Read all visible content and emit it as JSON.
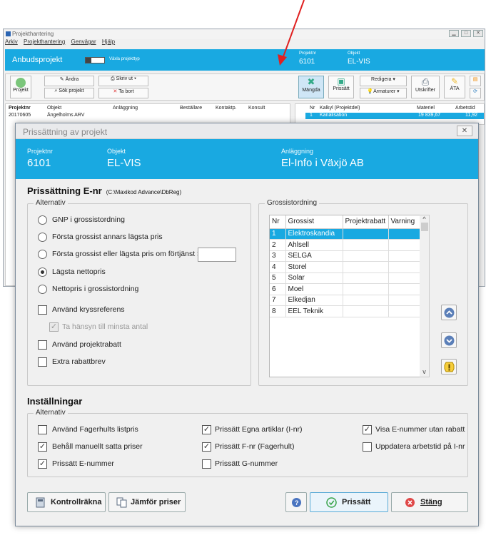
{
  "bg": {
    "window_title": "Projekthantering",
    "menu": [
      "Arkiv",
      "Projekthantering",
      "Genvägar",
      "Hjälp"
    ],
    "banner_title": "Anbudsprojekt",
    "banner_toggle_label": "Växla projekttyp",
    "projektnr_label": "Projektnr",
    "projektnr": "6101",
    "objekt_label": "Objekt",
    "objekt": "EL-VIS",
    "toolbar": {
      "projekt": "Projekt",
      "andra": "Ändra",
      "sok_projekt": "Sök projekt",
      "skriv_ut": "Skriv ut",
      "ta_bort": "Ta bort",
      "mangda": "Mängda",
      "prissatt": "Prissätt",
      "redigera": "Redigera",
      "armaturer": "Armaturer",
      "utskrifter": "Utskrifter",
      "ata": "ÄTA"
    },
    "left_columns": [
      "Projektnr",
      "Objekt",
      "Anläggning",
      "Beställare",
      "Kontaktp.",
      "Konsult"
    ],
    "left_row": [
      "20170605",
      "Ängelholms ARV"
    ],
    "right_columns": [
      "Nr",
      "Kalkyl (Projektdel)",
      "Materiel",
      "Arbetstid"
    ],
    "right_row": [
      "1",
      "Kanalisation",
      "19 839,67",
      "11,92"
    ]
  },
  "dialog": {
    "title": "Prissättning av projekt",
    "banner": {
      "projektnr_label": "Projektnr",
      "projektnr": "6101",
      "objekt_label": "Objekt",
      "objekt": "EL-VIS",
      "anlaggning_label": "Anläggning",
      "anlaggning": "El-Info i Växjö AB"
    },
    "heading": "Prissättning E-nr",
    "path": "(C:\\Maxikod Advance\\DbReg)",
    "alternativ_label": "Alternativ",
    "radios": [
      "GNP i grossistordning",
      "Första grossist annars lägsta pris",
      "Första grossist eller lägsta pris om förtjänst  >",
      "Lägsta nettopris",
      "Nettopris i grossistordning"
    ],
    "selected_radio": 3,
    "checkboxes": {
      "kryssreferens": {
        "label": "Använd kryssreferens",
        "checked": false
      },
      "minsta_antal": {
        "label": "Ta hänsyn till minsta antal",
        "checked": true
      },
      "projektrabatt": {
        "label": "Använd projektrabatt",
        "checked": false
      },
      "extra_rabattbrev": {
        "label": "Extra rabattbrev",
        "checked": false
      }
    },
    "profit_value": "",
    "grossist_label": "Grossistordning",
    "grid_columns": [
      "Nr",
      "Grossist",
      "Projektrabatt",
      "Varning"
    ],
    "grid_rows": [
      [
        "1",
        "Elektroskandia",
        "",
        ""
      ],
      [
        "2",
        "Ahlsell",
        "",
        ""
      ],
      [
        "3",
        "SELGA",
        "",
        ""
      ],
      [
        "4",
        "Storel",
        "",
        ""
      ],
      [
        "5",
        "Solar",
        "",
        ""
      ],
      [
        "6",
        "Moel",
        "",
        ""
      ],
      [
        "7",
        "Elkedjan",
        "",
        ""
      ],
      [
        "8",
        "EEL Teknik",
        "",
        ""
      ]
    ],
    "selected_grid_row": 0,
    "installningar_heading": "Inställningar",
    "installningar_alternativ": "Alternativ",
    "settings": [
      {
        "label": "Använd Fagerhults listpris",
        "checked": false
      },
      {
        "label": "Behåll manuellt satta priser",
        "checked": true
      },
      {
        "label": "Prissätt E-nummer",
        "checked": true
      },
      {
        "label": "Prissätt Egna artiklar (I-nr)",
        "checked": true
      },
      {
        "label": "Prissätt F-nr (Fagerhult)",
        "checked": true
      },
      {
        "label": "Prissätt G-nummer",
        "checked": false
      },
      {
        "label": "Visa E-nummer utan rabatt",
        "checked": true
      },
      {
        "label": "Uppdatera arbetstid på I-nr",
        "checked": false
      }
    ],
    "buttons": {
      "kontrollrakna": "Kontrollräkna",
      "jamfor_priser": "Jämför priser",
      "prissatt": "Prissätt",
      "stang": "Stäng"
    },
    "colors": {
      "accent": "#19a9e1",
      "selected_row": "#19a9e1"
    }
  }
}
